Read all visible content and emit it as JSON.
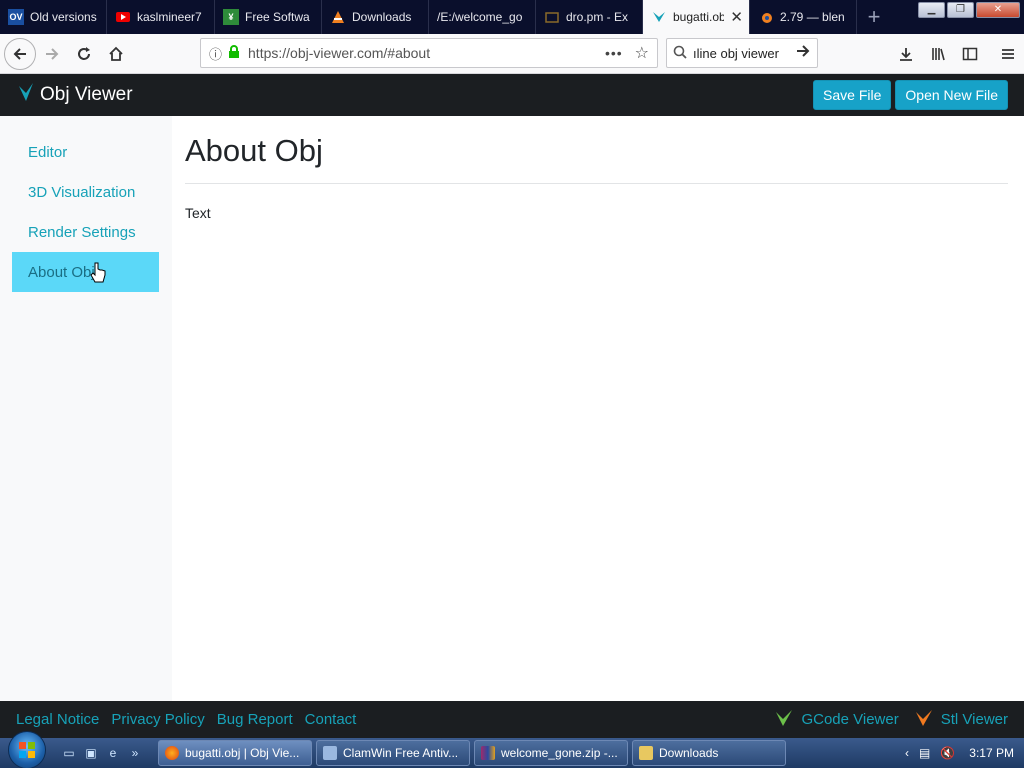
{
  "browser": {
    "tabs": [
      {
        "label": "Old versions",
        "icon": "oldversion-favicon",
        "color": "#1a4fa0",
        "active": false
      },
      {
        "label": "kaslmineer7",
        "icon": "youtube-favicon",
        "color": "#e00",
        "active": false
      },
      {
        "label": "Free Softwa",
        "icon": "software-favicon",
        "color": "#2e8b3a",
        "active": false
      },
      {
        "label": "Downloads",
        "icon": "vlc-favicon",
        "color": "#f08020",
        "active": false
      },
      {
        "label": "/E:/welcome_go",
        "icon": "file-favicon",
        "color": "#0a0f2c",
        "active": false
      },
      {
        "label": "dro.pm - Ex",
        "icon": "dropm-favicon",
        "color": "#8a6a2a",
        "active": false
      },
      {
        "label": "bugatti.ob",
        "icon": "objviewer-favicon",
        "color": "#17a2b8",
        "active": true
      },
      {
        "label": "2.79 — blen",
        "icon": "blender-favicon",
        "color": "#f08020",
        "active": false
      }
    ],
    "url": "https://obj-viewer.com/#about",
    "search_value": "ıline obj viewer"
  },
  "app": {
    "brand": "Obj Viewer",
    "save_label": "Save File",
    "open_label": "Open New File",
    "accent": "#17a2b8"
  },
  "sidebar": {
    "items": [
      {
        "label": "Editor",
        "active": false
      },
      {
        "label": "3D Visualization",
        "active": false
      },
      {
        "label": "Render Settings",
        "active": false
      },
      {
        "label": "About Obj",
        "active": true
      }
    ]
  },
  "main": {
    "title": "About Obj",
    "text": "Text"
  },
  "footer": {
    "links": [
      "Legal Notice",
      "Privacy Policy",
      "Bug Report",
      "Contact"
    ],
    "gcode": "GCode Viewer",
    "stl": "Stl Viewer"
  },
  "taskbar": {
    "tasks": [
      {
        "label": "bugatti.obj | Obj Vie...",
        "icon": "firefox-icon",
        "active": true
      },
      {
        "label": "ClamWin Free Antiv...",
        "icon": "clamwin-icon",
        "active": false
      },
      {
        "label": "welcome_gone.zip -...",
        "icon": "winrar-icon",
        "active": false
      },
      {
        "label": "Downloads",
        "icon": "folder-icon",
        "active": false
      }
    ],
    "clock": "3:17 PM"
  }
}
